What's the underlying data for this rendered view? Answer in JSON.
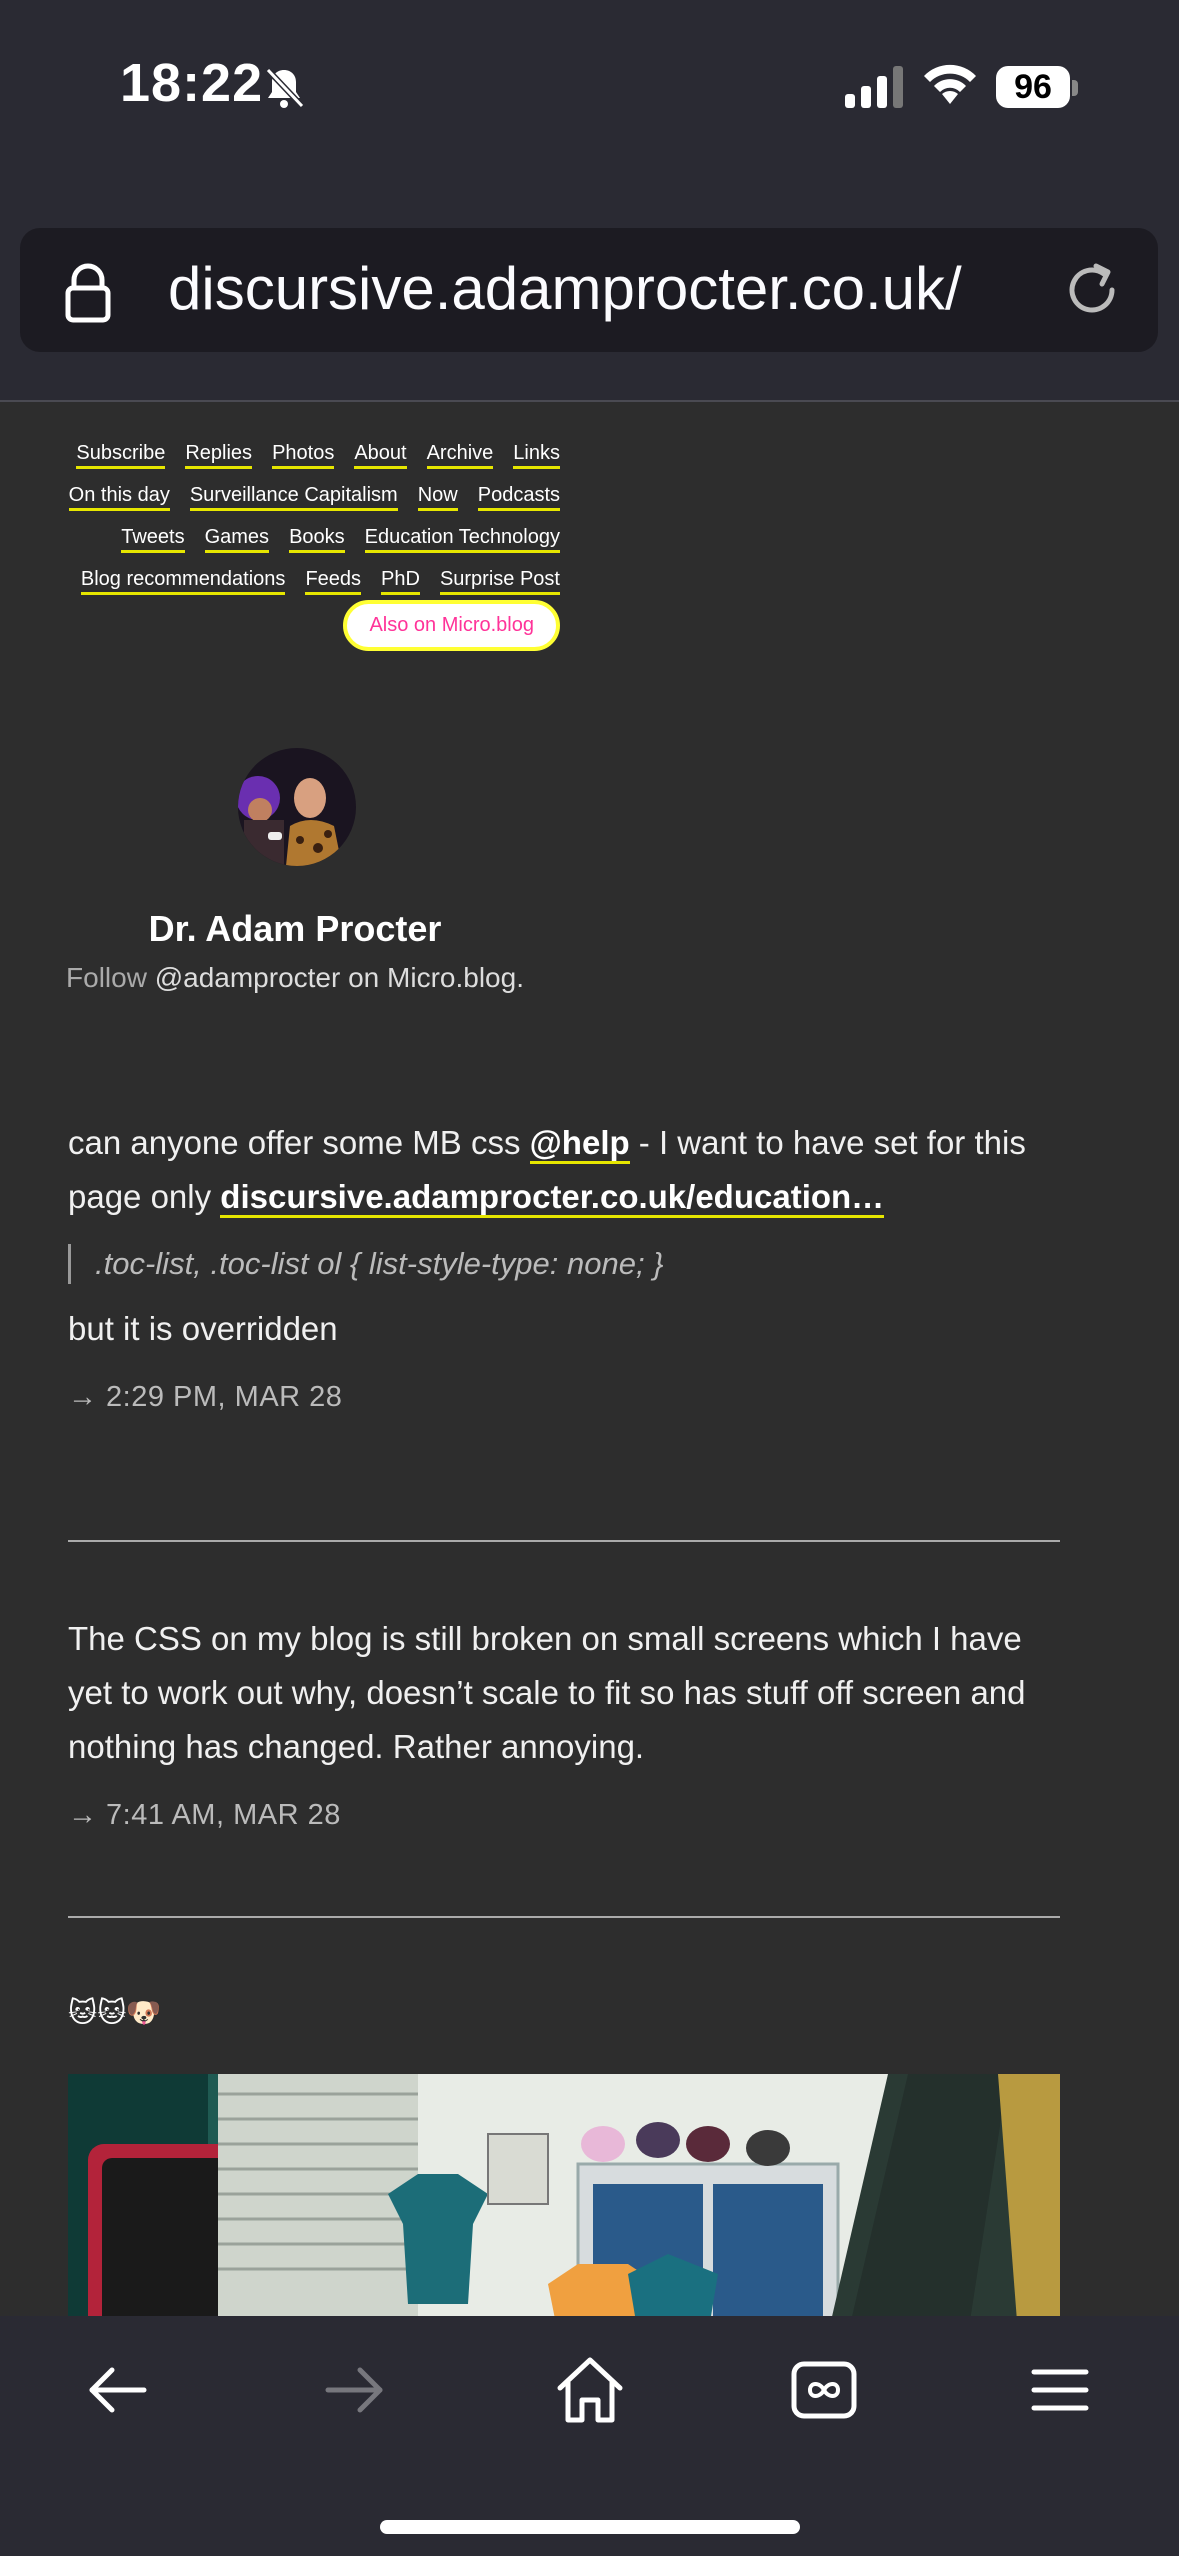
{
  "status_bar": {
    "time": "18:22",
    "battery": "96"
  },
  "browser": {
    "url": "discursive.adamprocter.co.uk/"
  },
  "nav": {
    "rows": [
      [
        "Subscribe",
        "Replies",
        "Photos",
        "About",
        "Archive",
        "Links"
      ],
      [
        "On this day",
        "Surveillance Capitalism",
        "Now",
        "Podcasts"
      ],
      [
        "Tweets",
        "Games",
        "Books",
        "Education Technology"
      ],
      [
        "Blog recommendations",
        "Feeds",
        "PhD",
        "Surprise Post"
      ]
    ],
    "also_button": "Also on Micro.blog"
  },
  "profile": {
    "name": "Dr. Adam Procter",
    "follow_prefix": "Follow",
    "handle": "@adamprocter",
    "follow_suffix": "on Micro.blog."
  },
  "posts": [
    {
      "text_a": "can anyone offer some MB css ",
      "mention": "@help",
      "text_b": " - I want to have set for this page only ",
      "link": "discursive.adamprocter.co.uk/education…",
      "quote": ".toc-list, .toc-list ol { list-style-type: none; }",
      "text_c": "but it is overridden",
      "timestamp": "→ 2:29 PM, MAR 28"
    },
    {
      "text": "The CSS on my blog is still broken on small screens which I have yet to work out why, doesn’t scale to fit so has stuff off screen and nothing has changed. Rather annoying.",
      "timestamp": "→ 7:41 AM, MAR 28"
    },
    {
      "emoji": "🐱🐱🐶"
    }
  ],
  "colors": {
    "background": "#2d2d2d",
    "accent_underline": "#e6e600",
    "button_text": "#ff3399"
  }
}
